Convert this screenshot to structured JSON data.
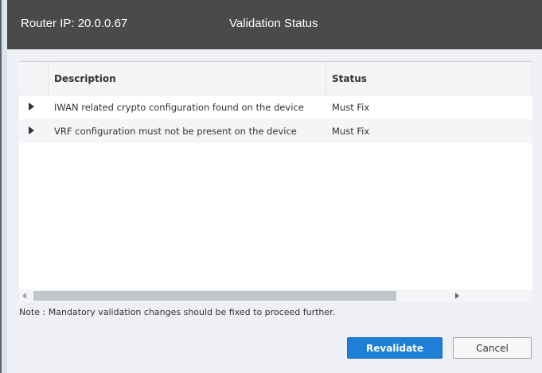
{
  "header": {
    "router_ip": "Router IP: 20.0.0.67",
    "title": "Validation Status"
  },
  "table": {
    "columns": [
      "Description",
      "Status"
    ],
    "rows": [
      {
        "description": "IWAN related crypto configuration found on the device",
        "status": "Must Fix"
      },
      {
        "description": "VRF configuration must not be present on the device",
        "status": "Must Fix"
      }
    ]
  },
  "note": "Note : Mandatory validation changes should be fixed to proceed further.",
  "buttons": {
    "revalidate": "Revalidate",
    "cancel": "Cancel"
  },
  "colors": {
    "header_bg": "#4a4a4a",
    "primary_button": "#1e7fd6",
    "dialog_bg": "#eef0f5"
  }
}
